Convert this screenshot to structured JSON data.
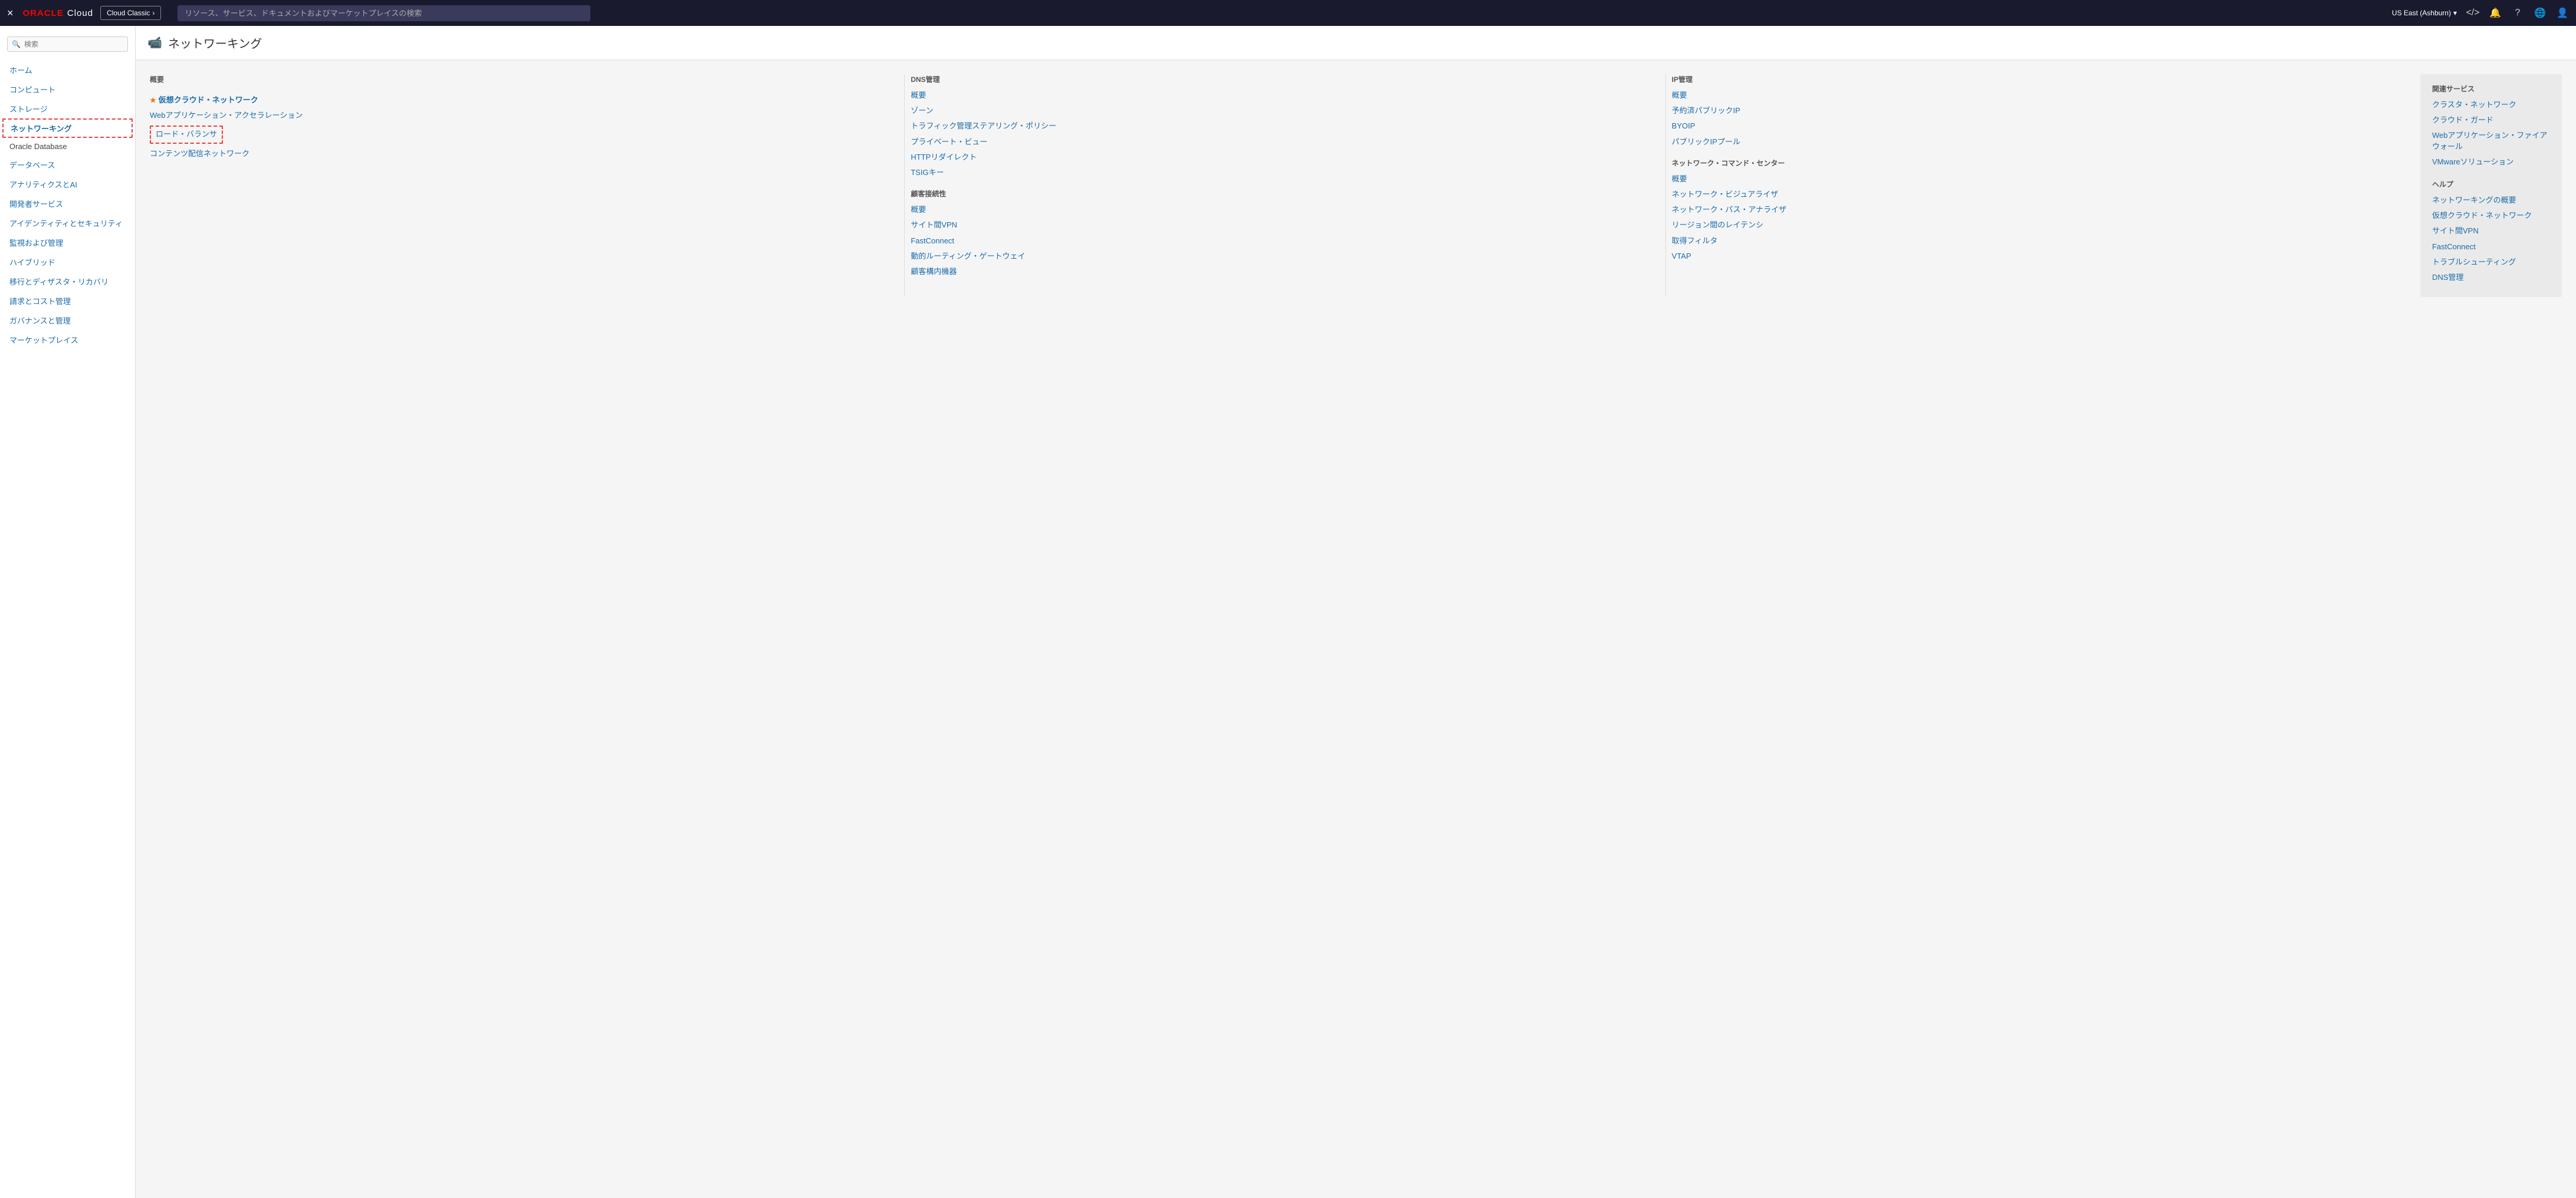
{
  "topnav": {
    "close_label": "×",
    "oracle_text": "ORACLE",
    "cloud_text": "Cloud",
    "cloud_classic_label": "Cloud Classic",
    "search_placeholder": "リソース、サービス、ドキュメントおよびマーケットプレイスの検索",
    "region_label": "US East (Ashburn)",
    "icons": {
      "code": "</>",
      "bell": "🔔",
      "help": "?",
      "globe": "🌐",
      "user": "👤"
    }
  },
  "sidebar": {
    "search_placeholder": "検索",
    "items": [
      {
        "label": "ホーム",
        "id": "home",
        "active": false
      },
      {
        "label": "コンピュート",
        "id": "compute",
        "active": false
      },
      {
        "label": "ストレージ",
        "id": "storage",
        "active": false
      },
      {
        "label": "ネットワーキング",
        "id": "networking",
        "active": true
      },
      {
        "label": "Oracle Database",
        "id": "oracle-db",
        "active": false,
        "plain": true
      },
      {
        "label": "データベース",
        "id": "database",
        "active": false
      },
      {
        "label": "アナリティクスとAI",
        "id": "analytics",
        "active": false
      },
      {
        "label": "開発者サービス",
        "id": "devservices",
        "active": false
      },
      {
        "label": "アイデンティティとセキュリティ",
        "id": "identity",
        "active": false
      },
      {
        "label": "監視および管理",
        "id": "monitoring",
        "active": false
      },
      {
        "label": "ハイブリッド",
        "id": "hybrid",
        "active": false
      },
      {
        "label": "移行とディザスタ・リカバリ",
        "id": "migration",
        "active": false
      },
      {
        "label": "請求とコスト管理",
        "id": "billing",
        "active": false
      },
      {
        "label": "ガバナンスと管理",
        "id": "governance",
        "active": false
      },
      {
        "label": "マーケットプレイス",
        "id": "marketplace",
        "active": false
      }
    ]
  },
  "page": {
    "title": "ネットワーキング",
    "icon": "🔲"
  },
  "menu": {
    "col1": {
      "sections": [
        {
          "title": "概要",
          "links": []
        },
        {
          "featured": true,
          "label": "仮想クラウド・ネットワーク",
          "links": [
            {
              "label": "Webアプリケーション・アクセラレーション",
              "boxed": false
            },
            {
              "label": "ロード・バランサ",
              "boxed": true
            },
            {
              "label": "コンテンツ配信ネットワーク",
              "boxed": false
            }
          ]
        }
      ]
    },
    "col2": {
      "sections": [
        {
          "title": "DNS管理",
          "links": [
            {
              "label": "概要"
            },
            {
              "label": "ゾーン"
            },
            {
              "label": "トラフィック管理ステアリング・ポリシー"
            },
            {
              "label": "プライベート・ビュー"
            },
            {
              "label": "HTTPリダイレクト"
            },
            {
              "label": "TSIGキー"
            }
          ]
        },
        {
          "title": "顧客接続性",
          "links": [
            {
              "label": "概要"
            },
            {
              "label": "サイト間VPN"
            },
            {
              "label": "FastConnect"
            },
            {
              "label": "動的ルーティング・ゲートウェイ"
            },
            {
              "label": "顧客構内機器"
            }
          ]
        }
      ]
    },
    "col3": {
      "sections": [
        {
          "title": "IP管理",
          "links": [
            {
              "label": "概要"
            },
            {
              "label": "予約済パブリックIP"
            },
            {
              "label": "BYOIP"
            },
            {
              "label": "パブリックIPプール"
            }
          ]
        },
        {
          "title": "ネットワーク・コマンド・センター",
          "links": [
            {
              "label": "概要"
            },
            {
              "label": "ネットワーク・ビジュアライザ"
            },
            {
              "label": "ネットワーク・パス・アナライザ"
            },
            {
              "label": "リージョン間のレイテンシ"
            },
            {
              "label": "取得フィルタ"
            },
            {
              "label": "VTAP"
            }
          ]
        }
      ]
    },
    "col4": {
      "related_title": "関連サービス",
      "related_links": [
        {
          "label": "クラスタ・ネットワーク"
        },
        {
          "label": "クラウド・ガード"
        },
        {
          "label": "Webアプリケーション・ファイアウォール"
        },
        {
          "label": "VMwareソリューション"
        }
      ],
      "help_title": "ヘルプ",
      "help_links": [
        {
          "label": "ネットワーキングの概要"
        },
        {
          "label": "仮想クラウド・ネットワーク"
        },
        {
          "label": "サイト間VPN"
        },
        {
          "label": "FastConnect"
        },
        {
          "label": "トラブルシューティング"
        },
        {
          "label": "DNS管理"
        }
      ]
    }
  }
}
